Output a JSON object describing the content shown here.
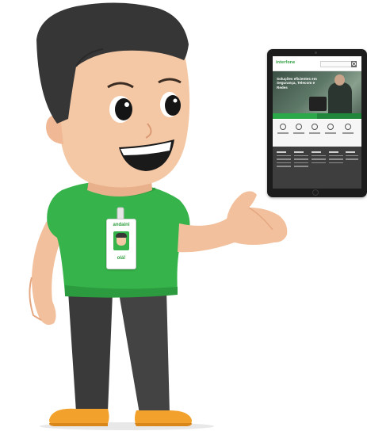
{
  "tablet": {
    "site": {
      "logo": "interfone",
      "hero_title": "Soluções eficientes em Segurança, Telecom e Redes"
    }
  },
  "character": {
    "badge_brand": "andaini",
    "badge_caption": "olá!"
  },
  "colors": {
    "shirt_green": "#36b34a",
    "badge_green": "#2e9e3e",
    "shoe_orange": "#f2a22c",
    "pants_gray": "#3d3d3d",
    "hair": "#363636",
    "skin": "#f5c8a5"
  }
}
